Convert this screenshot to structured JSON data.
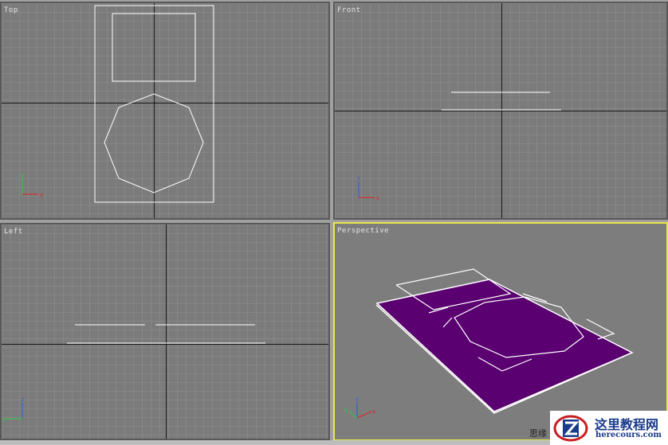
{
  "viewports": {
    "top": {
      "label": "Top"
    },
    "front": {
      "label": "Front"
    },
    "left": {
      "label": "Left"
    },
    "perspective": {
      "label": "Perspective"
    }
  },
  "axis_labels": {
    "x": "x",
    "y": "y",
    "z": "z"
  },
  "watermark": {
    "prefix": "思缘",
    "title": "这里教程网",
    "url": "herecours.com"
  },
  "colors": {
    "viewport_bg": "#7b7b7b",
    "grid_line": "#878787",
    "active_border": "#e8e84a",
    "shape_fill": "#5a0070",
    "wire": "#ffffff"
  }
}
